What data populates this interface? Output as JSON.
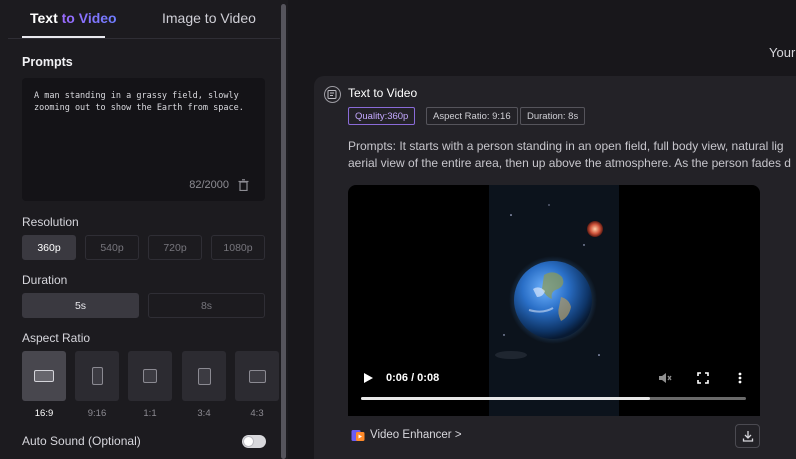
{
  "tabs": {
    "text_to_video_bold": "Text",
    "text_to_video_rest": "to Video",
    "image_to_video": "Image to Video"
  },
  "prompts": {
    "title": "Prompts",
    "text": "A man standing in a grassy field, slowly zooming out to show the Earth from space.",
    "char_count": "82/2000"
  },
  "resolution": {
    "title": "Resolution",
    "options": [
      "360p",
      "540p",
      "720p",
      "1080p"
    ],
    "selected": "360p"
  },
  "duration": {
    "title": "Duration",
    "options": [
      "5s",
      "8s"
    ],
    "selected": "5s"
  },
  "aspect_ratio": {
    "title": "Aspect Ratio",
    "options": [
      "16:9",
      "9:16",
      "1:1",
      "3:4",
      "4:3"
    ],
    "selected": "16:9"
  },
  "auto_sound": {
    "label": "Auto Sound (Optional)",
    "enabled": false
  },
  "header": {
    "your_label": "Your"
  },
  "result": {
    "title": "Text to Video",
    "tags": {
      "quality": "Quality:360p",
      "aspect": "Aspect Ratio: 9:16",
      "duration": "Duration: 8s"
    },
    "prompt_line1": "Prompts:  It starts with a person standing in an open field, full body view, natural lig",
    "prompt_line2": "aerial view of the entire area, then up above the atmosphere. As the person fades d",
    "video": {
      "time": "0:06 / 0:08",
      "progress": 0.75
    },
    "enhancer_label": "Video Enhancer >"
  },
  "colors": {
    "accent_purple": "#9b6bff",
    "accent_blue": "#6e7dff",
    "panel_bg": "#1c1b1f",
    "card_bg": "#232227"
  }
}
